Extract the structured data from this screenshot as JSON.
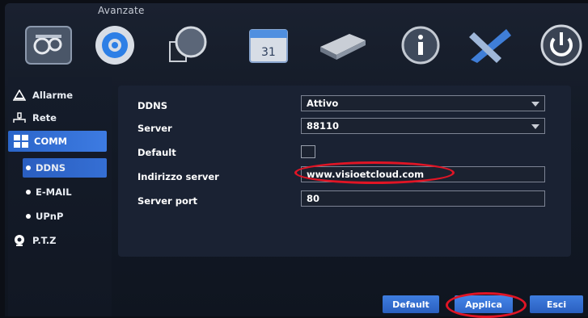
{
  "window": {
    "title": "Avanzate"
  },
  "toolbar": {
    "icons": [
      "advanced-settings-icon",
      "gear-icon",
      "disk-icon",
      "calendar-icon",
      "hdd-icon",
      "info-icon",
      "tools-icon",
      "power-icon"
    ]
  },
  "sidebar": {
    "items": [
      {
        "label": "Allarme",
        "icon": "alarm-icon"
      },
      {
        "label": "Rete",
        "icon": "network-icon"
      },
      {
        "label": "COMM",
        "icon": "comm-grid-icon"
      },
      {
        "label": "DDNS"
      },
      {
        "label": "E-MAIL"
      },
      {
        "label": "UPnP"
      },
      {
        "label": "P.T.Z",
        "icon": "camera-icon"
      }
    ]
  },
  "form": {
    "ddns_label": "DDNS",
    "ddns_value": "Attivo",
    "server_label": "Server",
    "server_value": "88110",
    "default_label": "Default",
    "address_label": "Indirizzo server",
    "address_value": "www.visioetcloud.com",
    "port_label": "Server port",
    "port_value": "80"
  },
  "buttons": {
    "default": "Default",
    "apply": "Applica",
    "exit": "Esci"
  },
  "colors": {
    "accent": "#2f6fd6",
    "highlight_oval": "#e01525"
  }
}
